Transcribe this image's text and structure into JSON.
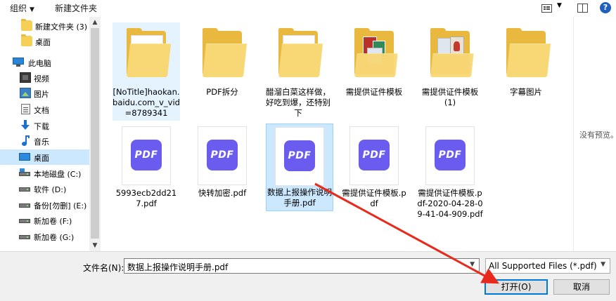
{
  "toolbar": {
    "organize_label": "组织",
    "new_folder_label": "新建文件夹"
  },
  "nav": {
    "items": [
      {
        "label": "新建文件夹 (3)",
        "icon": "folder-icon"
      },
      {
        "label": "桌面",
        "icon": "folder-icon"
      },
      {
        "label": "此电脑",
        "icon": "computer-icon"
      },
      {
        "label": "视频",
        "icon": "video-icon"
      },
      {
        "label": "图片",
        "icon": "pictures-icon"
      },
      {
        "label": "文档",
        "icon": "documents-icon"
      },
      {
        "label": "下载",
        "icon": "download-icon"
      },
      {
        "label": "音乐",
        "icon": "music-icon"
      },
      {
        "label": "桌面",
        "icon": "desktop-icon",
        "selected": true
      },
      {
        "label": "本地磁盘 (C:)",
        "icon": "drive-icon"
      },
      {
        "label": "软件 (D:)",
        "icon": "drive-icon"
      },
      {
        "label": "备份[勿删] (E:)",
        "icon": "drive-icon"
      },
      {
        "label": "新加卷 (F:)",
        "icon": "drive-icon"
      },
      {
        "label": "新加卷 (G:)",
        "icon": "drive-icon"
      }
    ]
  },
  "files": [
    {
      "name": "[NoTitle]haokan.baidu.com_v_vid=8789341",
      "type": "folder"
    },
    {
      "name": "PDF拆分",
      "type": "folder"
    },
    {
      "name": "醋溜白菜这样做，好吃到爆，还特别下",
      "type": "folder"
    },
    {
      "name": "需提供证件模板",
      "type": "folder"
    },
    {
      "name": "需提供证件模板(1)",
      "type": "folder"
    },
    {
      "name": "字幕图片",
      "type": "folder"
    },
    {
      "name": "5993ecb2dd217.pdf",
      "type": "pdf"
    },
    {
      "name": "快转加密.pdf",
      "type": "pdf"
    },
    {
      "name": "数据上报操作说明手册.pdf",
      "type": "pdf",
      "selected": true
    },
    {
      "name": "需提供证件模板.pdf",
      "type": "pdf"
    },
    {
      "name": "需提供证件模板.pdf-2020-04-28-09-41-04-909.pdf",
      "type": "pdf"
    }
  ],
  "pdf_badge_text": "PDF",
  "preview": {
    "message": "没有预览。"
  },
  "bottom": {
    "filename_label": "文件名(N):",
    "filename_value": "数据上报操作说明手册.pdf",
    "filter_value": "All Supported Files (*.pdf)",
    "open_label": "打开(O)",
    "cancel_label": "取消"
  },
  "colors": {
    "selection": "#cce8ff",
    "pdf_badge": "#6b5cf0",
    "arrow": "#e8291c",
    "default_button_border": "#0078d7"
  }
}
